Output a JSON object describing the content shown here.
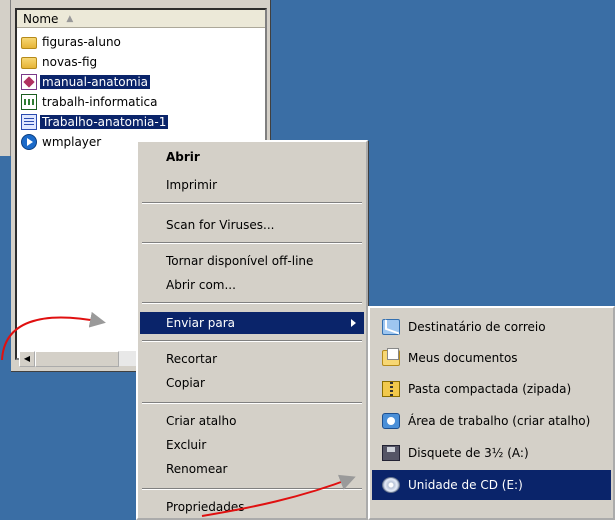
{
  "file_list": {
    "column_header": "Nome",
    "items": [
      {
        "icon": "folder-icon",
        "label": "figuras-aluno",
        "selected": false
      },
      {
        "icon": "folder-icon",
        "label": "novas-fig",
        "selected": false
      },
      {
        "icon": "pdf-file-icon",
        "label": "manual-anatomia",
        "selected": true
      },
      {
        "icon": "spreadsheet-file-icon",
        "label": "trabalh-informatica",
        "selected": false
      },
      {
        "icon": "document-file-icon",
        "label": "Trabalho-anatomia-1",
        "selected": true
      },
      {
        "icon": "media-player-icon",
        "label": "wmplayer",
        "selected": false
      }
    ]
  },
  "context_menu": {
    "open": "Abrir",
    "print": "Imprimir",
    "scan": "Scan for Viruses...",
    "offline": "Tornar disponível off-line",
    "open_with": "Abrir com...",
    "send_to": "Enviar para",
    "cut": "Recortar",
    "copy": "Copiar",
    "shortcut": "Criar atalho",
    "delete": "Excluir",
    "rename": "Renomear",
    "properties": "Propriedades"
  },
  "send_to_menu": {
    "items": [
      {
        "icon": "mail-recipient-icon",
        "label": "Destinatário de correio"
      },
      {
        "icon": "my-documents-icon",
        "label": "Meus documentos"
      },
      {
        "icon": "zip-folder-icon",
        "label": "Pasta compactada (zipada)"
      },
      {
        "icon": "desktop-icon",
        "label": "Área de trabalho (criar atalho)"
      },
      {
        "icon": "floppy-drive-icon",
        "label": "Disquete de 3½ (A:)"
      },
      {
        "icon": "cd-drive-icon",
        "label": "Unidade de CD (E:)"
      }
    ],
    "highlighted": "Unidade de CD (E:)"
  },
  "colors": {
    "desktop": "#3a6ea5",
    "selection": "#0a246a",
    "annotation_arrow": "#e01010"
  }
}
